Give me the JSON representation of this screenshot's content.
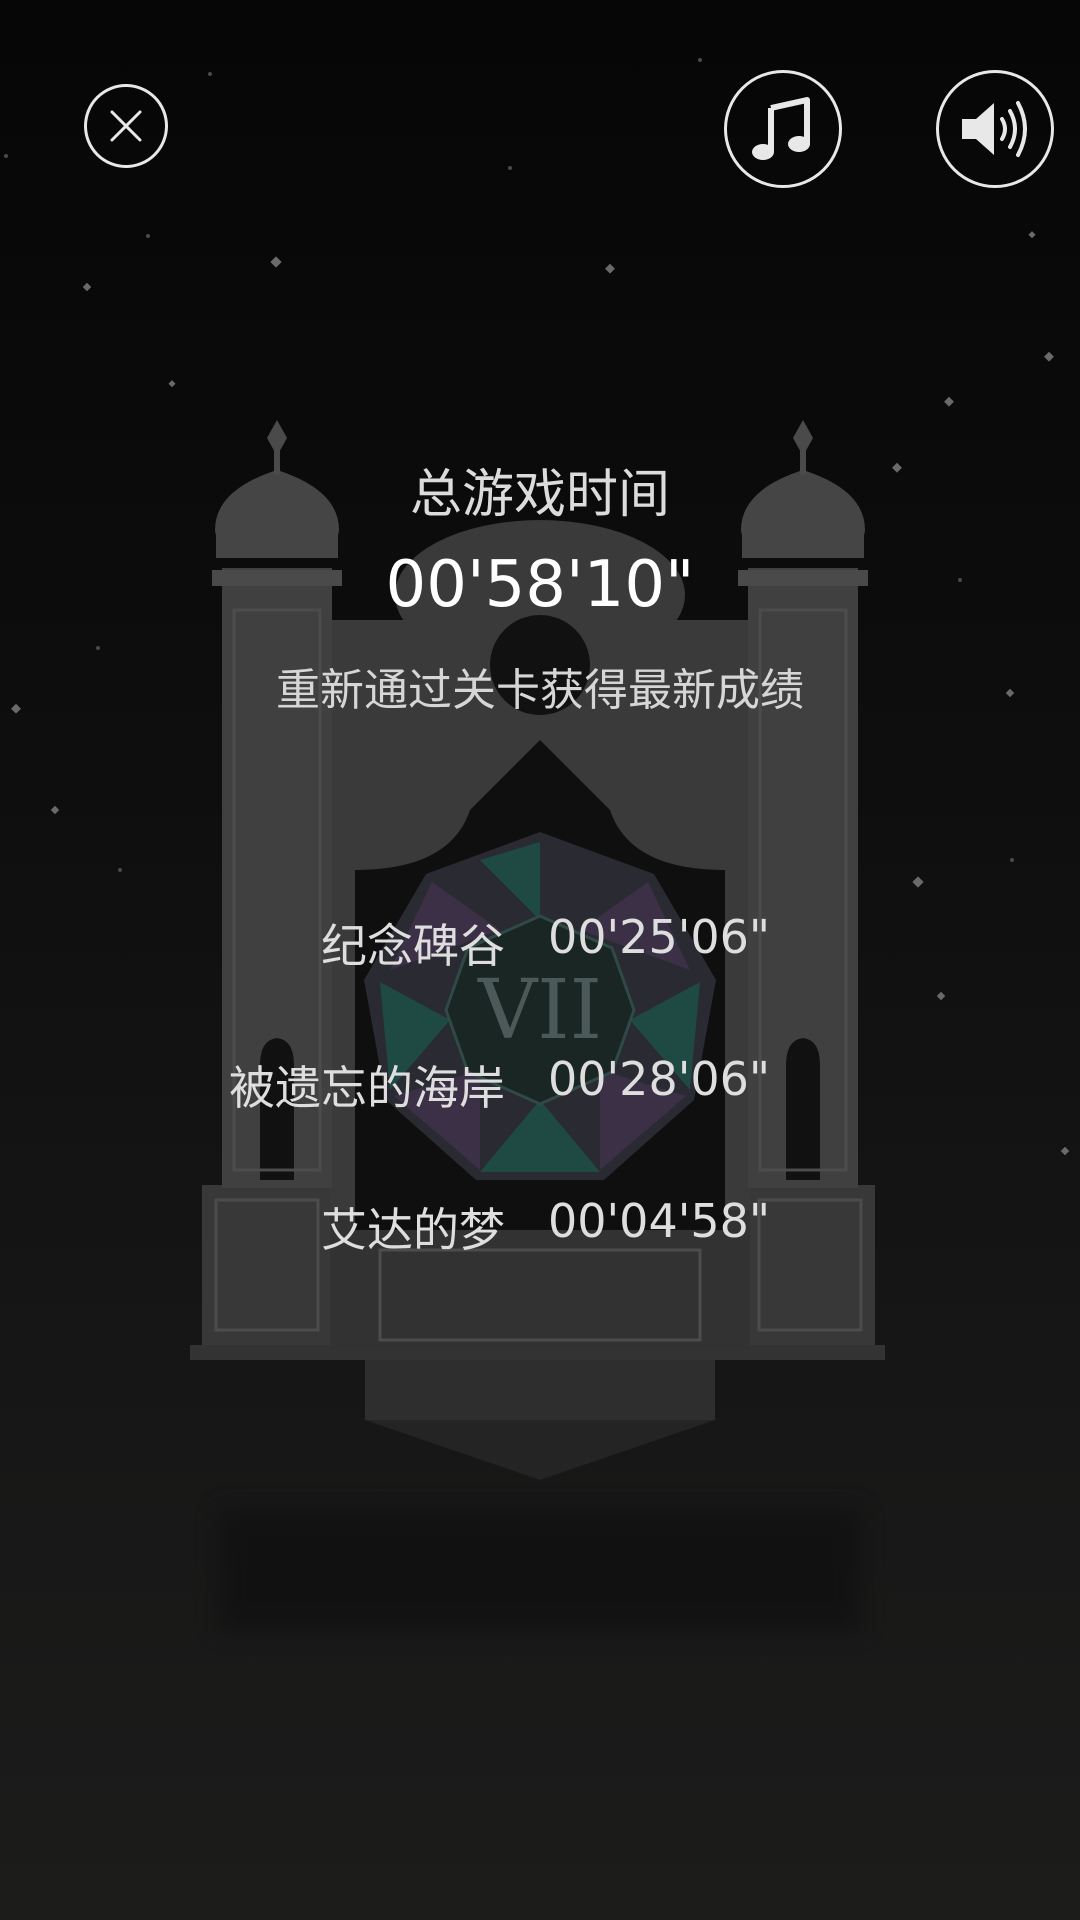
{
  "controls": {
    "close_icon": "close-icon",
    "music_icon": "music-note-icon",
    "sound_icon": "speaker-icon"
  },
  "summary": {
    "total_label": "总游戏时间",
    "total_time": "00'58'10\"",
    "hint": "重新通过关卡获得最新成绩"
  },
  "levels": [
    {
      "name": "纪念碑谷",
      "time": "00'25'06\""
    },
    {
      "name": "被遗忘的海岸",
      "time": "00'28'06\""
    },
    {
      "name": "艾达的梦",
      "time": "00'04'58\""
    }
  ],
  "monument": {
    "numeral": "VII"
  },
  "colors": {
    "background": "#0a0a0a",
    "text": "#e6e6e6",
    "stone": "#3a3a3a",
    "gem_teal": "#1f4a44",
    "gem_purple": "#3a2e44"
  }
}
